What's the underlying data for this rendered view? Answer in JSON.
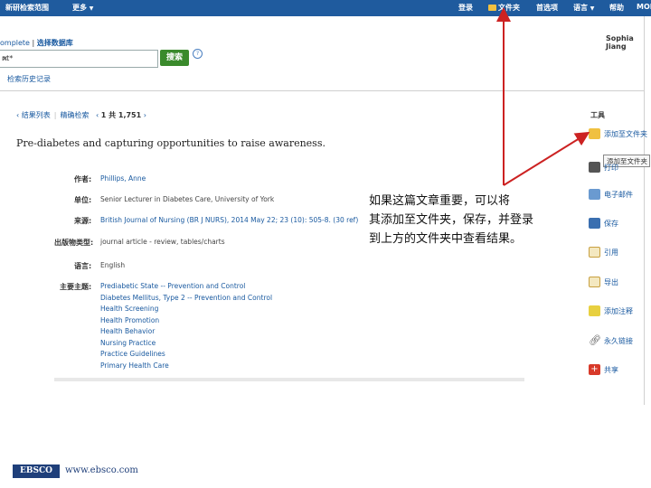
{
  "topbar": {
    "new_search": "新研检索范围",
    "more": "更多",
    "signin": "登录",
    "folder": "文件夹",
    "preferences": "首选项",
    "language": "语言",
    "help": "帮助",
    "mobile": "MOBILE"
  },
  "search": {
    "db_complete": "omplete",
    "db_separator": "|",
    "choose_db": "选择数据库",
    "query": "nt*",
    "search_button": "搜索",
    "help": "?",
    "history": "检索历史记录"
  },
  "user": {
    "name": "Sophia Jiang"
  },
  "result_nav": {
    "back": "‹ 结果列表",
    "refine": "精确检索",
    "prev": "‹",
    "position": "1 共 1,751",
    "next": "›"
  },
  "article": {
    "title": "Pre-diabetes and capturing opportunities to raise awareness.",
    "fields": [
      {
        "label": "作者:",
        "value": "Phillips, Anne",
        "link": true
      },
      {
        "label": "单位:",
        "value": "Senior Lecturer in Diabetes Care, University of York",
        "link": false
      },
      {
        "label": "来源:",
        "value": "British Journal of Nursing (BR J NURS), 2014 May 22; 23 (10): 505-8. (30 ref)",
        "link": true
      },
      {
        "label": "出版物类型:",
        "value": "journal article - review, tables/charts",
        "link": false
      },
      {
        "label": "语言:",
        "value": "English",
        "link": false
      }
    ],
    "subjects_label": "主要主题:",
    "subjects": [
      "Prediabetic State -- Prevention and Control",
      "Diabetes Mellitus, Type 2 -- Prevention and Control",
      "Health Screening",
      "Health Promotion",
      "Health Behavior",
      "Nursing Practice",
      "Practice Guidelines",
      "Primary Health Care"
    ]
  },
  "tools": {
    "heading": "工具",
    "items": [
      {
        "label": "添加至文件夹",
        "icon": "folder-icon"
      },
      {
        "label": "打印",
        "icon": "print-icon"
      },
      {
        "label": "电子邮件",
        "icon": "email-icon"
      },
      {
        "label": "保存",
        "icon": "save-icon"
      },
      {
        "label": "引用",
        "icon": "cite-icon"
      },
      {
        "label": "导出",
        "icon": "export-icon"
      },
      {
        "label": "添加注释",
        "icon": "note-icon"
      },
      {
        "label": "永久链接",
        "icon": "link-icon"
      },
      {
        "label": "共享",
        "icon": "share-icon"
      }
    ],
    "tooltip": "添加至文件夹"
  },
  "annotation": {
    "line1": "如果这篇文章重要，可以将",
    "line2": "其添加至文件夹，保存，并登录",
    "line3": "到上方的文件夹中查看结果。"
  },
  "footer": {
    "logo": "EBSCO",
    "url": "www.ebsco.com"
  },
  "colors": {
    "nav": "#1f5b9e",
    "link": "#1a5aa0",
    "search_button": "#3a8a2c",
    "arrow": "#cc2222"
  }
}
